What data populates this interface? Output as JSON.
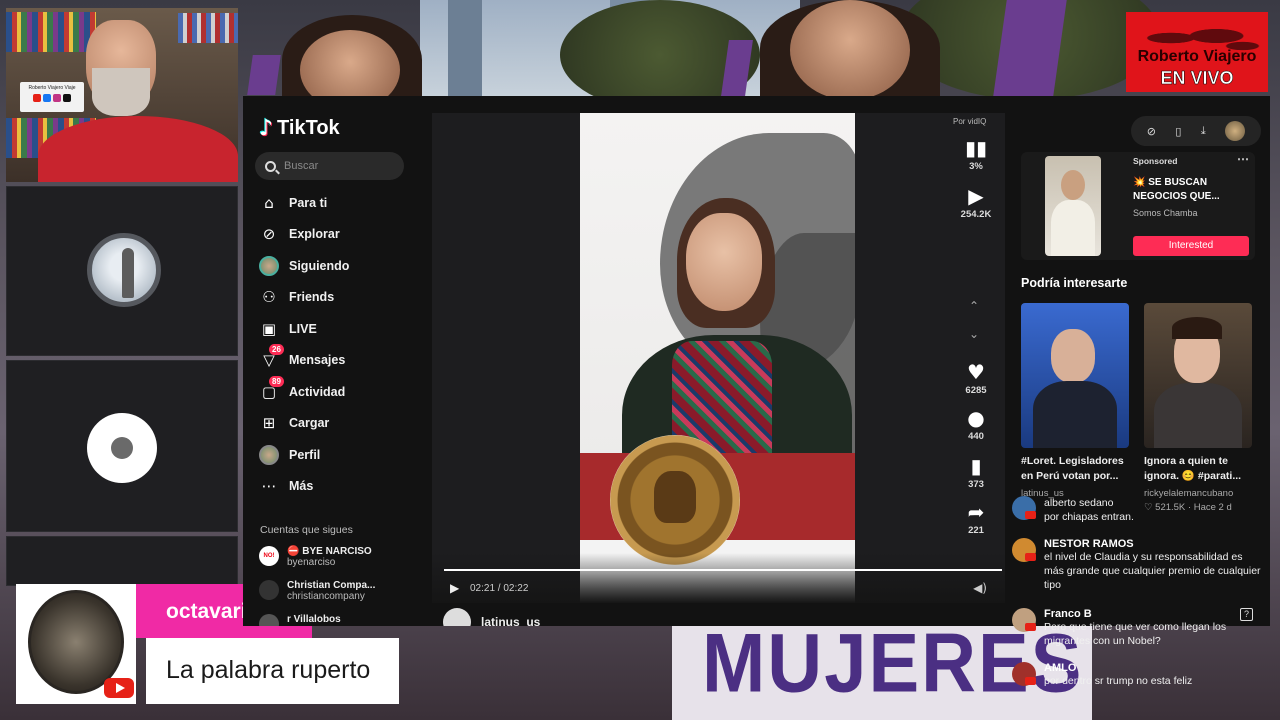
{
  "stream": {
    "background_sign": "MUJERES",
    "badge_line1": "Roberto Viajero",
    "badge_line2": "EN VIVO",
    "host_sign": "Roberto Viajero Viaje",
    "lower_third": {
      "name": "octavarium",
      "message": "La palabra ruperto"
    }
  },
  "tiktok": {
    "logo": "TikTok",
    "search_placeholder": "Buscar",
    "nav": [
      {
        "label": "Para ti",
        "icon": "home-icon"
      },
      {
        "label": "Explorar",
        "icon": "compass-icon"
      },
      {
        "label": "Siguiendo",
        "icon": "following-avatar-icon"
      },
      {
        "label": "Friends",
        "icon": "friends-icon"
      },
      {
        "label": "LIVE",
        "icon": "live-icon"
      },
      {
        "label": "Mensajes",
        "icon": "messages-icon",
        "badge": "26"
      },
      {
        "label": "Actividad",
        "icon": "activity-icon",
        "badge": "89"
      },
      {
        "label": "Cargar",
        "icon": "upload-icon"
      },
      {
        "label": "Perfil",
        "icon": "profile-icon"
      },
      {
        "label": "Más",
        "icon": "more-icon"
      }
    ],
    "following_title": "Cuentas que sigues",
    "following": [
      {
        "name": "⛔ BYE NARCISO",
        "handle": "byenarciso"
      },
      {
        "name": "Christian Compa...",
        "handle": "christiancompany"
      },
      {
        "name": "r Villalobos",
        "handle": ""
      }
    ],
    "video": {
      "watermark": "Por vidIQ",
      "stat_percent": "3%",
      "views": "254.2K",
      "likes": "6285",
      "comments": "440",
      "saves": "373",
      "shares": "221",
      "time": "02:21 / 02:22",
      "author": "latinus_us"
    },
    "sponsored": {
      "label": "Sponsored",
      "title": "💥 SE BUSCAN NEGOCIOS QUE...",
      "brand": "Somos Chamba",
      "button": "Interested"
    },
    "may_like_title": "Podría interesarte",
    "recommendations": [
      {
        "caption": "#Loret. Legisladores en Perú votan por...",
        "author": "latinus_us",
        "stats": "",
        "date": ""
      },
      {
        "caption": "Ignora a quien te ignora. 😊 #parati...",
        "author": "rickyelalemancubano",
        "stats": "521.5K",
        "date": "Hace 2 d"
      }
    ]
  },
  "chat": [
    {
      "name": "alberto sedano",
      "text": "por chiapas entran.",
      "color": "#3a6ea8"
    },
    {
      "name": "NESTOR RAMOS",
      "text": "el nivel de Claudia y su responsabilidad es más grande que cualquier premio de cualquier tipo",
      "color": "#d08a30"
    },
    {
      "name": "Franco B",
      "text": "Pero que tiene que ver como llegan los migrantes con un Nobel?",
      "color": "#c0a080"
    },
    {
      "name": "AMLO",
      "text": "por dentro sr trump no esta feliz",
      "color": "#a0302a"
    }
  ]
}
